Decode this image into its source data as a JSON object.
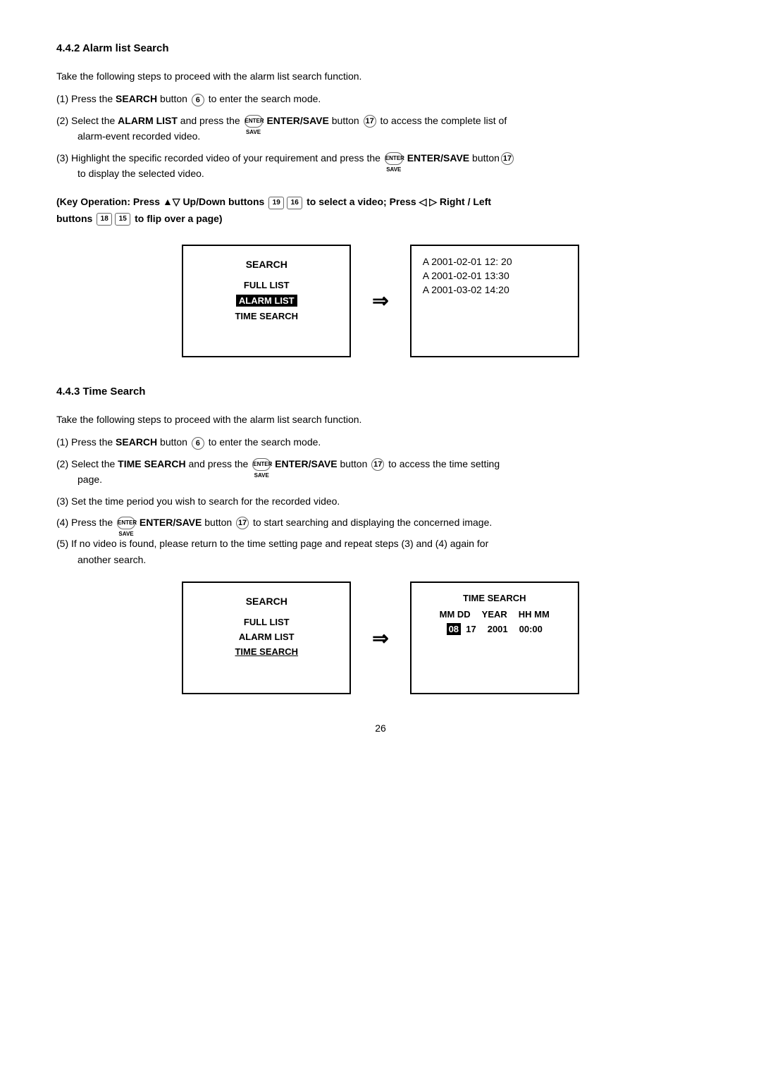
{
  "section442": {
    "title": "4.4.2 Alarm list Search",
    "intro": "Take the following steps to proceed with the alarm list search function.",
    "steps": [
      {
        "number": "(1)",
        "text": "Press the ",
        "bold1": "SEARCH",
        "mid1": " button ",
        "icon1": "6",
        "rest": " to enter the search mode."
      },
      {
        "number": "(2)",
        "text": "Select the ",
        "bold1": "ALARM LIST",
        "mid1": " and press the ",
        "icon1": "ENTER",
        "bold2": "ENTER/SAVE",
        "mid2": " button ",
        "icon2": "17",
        "rest": " to access the complete list of",
        "indent": "alarm-event recorded video."
      },
      {
        "number": "(3)",
        "text": "Highlight the specific recorded video of your requirement and press the ",
        "icon1": "ENTER",
        "bold1": "ENTER/SAVE",
        "mid1": " button",
        "icon2": "17",
        "rest": "",
        "indent": "to display the selected video."
      }
    ],
    "key_operation": "(Key Operation: Press ▲▽ Up/Down buttons",
    "key_op_icons": "19 16",
    "key_op_mid": "to select a video; Press ◁ ▷ Right / Left",
    "key_op_end": "buttons",
    "key_op_icons2": "18 15",
    "key_op_end2": "to flip over a page)",
    "diagram": {
      "left": {
        "title": "SEARCH",
        "items": [
          "FULL LIST",
          "ALARM LIST",
          "TIME SEARCH"
        ],
        "highlighted": "ALARM LIST"
      },
      "right": {
        "items": [
          "A 2001-02-01 12: 20",
          "A 2001-02-01 13:30",
          "A 2001-03-02 14:20"
        ],
        "highlighted_index": 0
      }
    }
  },
  "section443": {
    "title": "4.4.3 Time Search",
    "intro": "Take the following steps to proceed with the alarm list search function.",
    "steps": [
      {
        "number": "(1)",
        "text": "Press the ",
        "bold1": "SEARCH",
        "mid1": " button ",
        "icon1": "6",
        "rest": " to enter the search mode."
      },
      {
        "number": "(2)",
        "text": "Select the ",
        "bold1": "TIME SEARCH",
        "mid1": " and press the ",
        "icon1": "ENTER",
        "bold2": "ENTER/SAVE",
        "mid2": " button ",
        "icon2": "17",
        "rest": " to access the time setting",
        "indent": "page."
      },
      {
        "number": "(3)",
        "text": "Set the time period you wish to search for the recorded video.",
        "rest": ""
      },
      {
        "number": "(4)",
        "text": "Press the ",
        "icon1": "ENTER",
        "bold1": "ENTER/SAVE",
        "mid1": " button ",
        "icon2": "17",
        "rest": " to start searching and displaying the concerned image."
      },
      {
        "number": "(5)",
        "text": "If no video is found, please return to the time setting page and repeat steps (3) and (4) again for",
        "indent": "another search."
      }
    ],
    "diagram": {
      "left": {
        "title": "SEARCH",
        "items": [
          "FULL LIST",
          "ALARM LIST",
          "TIME SEARCH"
        ],
        "highlighted": "TIME SEARCH"
      },
      "right": {
        "title": "TIME SEARCH",
        "cols": [
          "MM DD",
          "YEAR",
          "HH MM"
        ],
        "vals": [
          "08   17",
          "2001",
          "00:00"
        ],
        "highlighted_col": "MM DD",
        "highlighted_val": "08"
      }
    }
  },
  "page_number": "26"
}
